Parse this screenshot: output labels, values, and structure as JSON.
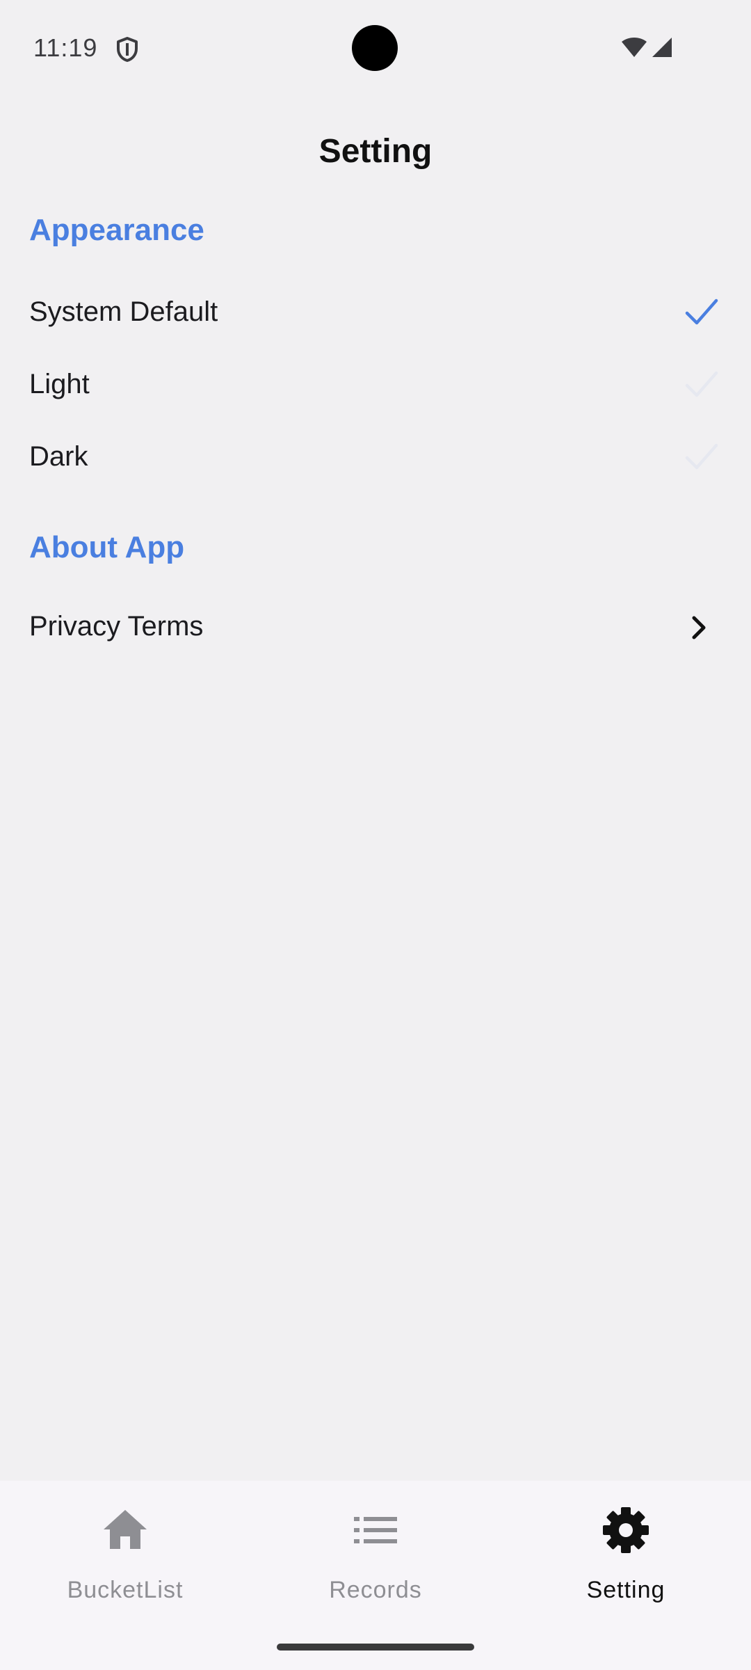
{
  "status_bar": {
    "time": "11:19",
    "icons": [
      "shield-icon",
      "wifi-icon",
      "signal-icon"
    ]
  },
  "header": {
    "title": "Setting"
  },
  "appearance": {
    "section_title": "Appearance",
    "options": [
      {
        "label": "System Default",
        "selected": true
      },
      {
        "label": "Light",
        "selected": false
      },
      {
        "label": "Dark",
        "selected": false
      }
    ]
  },
  "about": {
    "section_title": "About App",
    "items": [
      {
        "label": "Privacy Terms",
        "icon": "chevron-right-icon"
      }
    ]
  },
  "bottom_nav": {
    "items": [
      {
        "label": "BucketList",
        "icon": "home-icon",
        "active": false
      },
      {
        "label": "Records",
        "icon": "list-icon",
        "active": false
      },
      {
        "label": "Setting",
        "icon": "gear-icon",
        "active": true
      }
    ]
  },
  "colors": {
    "accent": "#4a7fe0",
    "background": "#f1f0f2",
    "nav_background": "#f7f5f9",
    "inactive": "#8e8e93",
    "active": "#111111"
  }
}
